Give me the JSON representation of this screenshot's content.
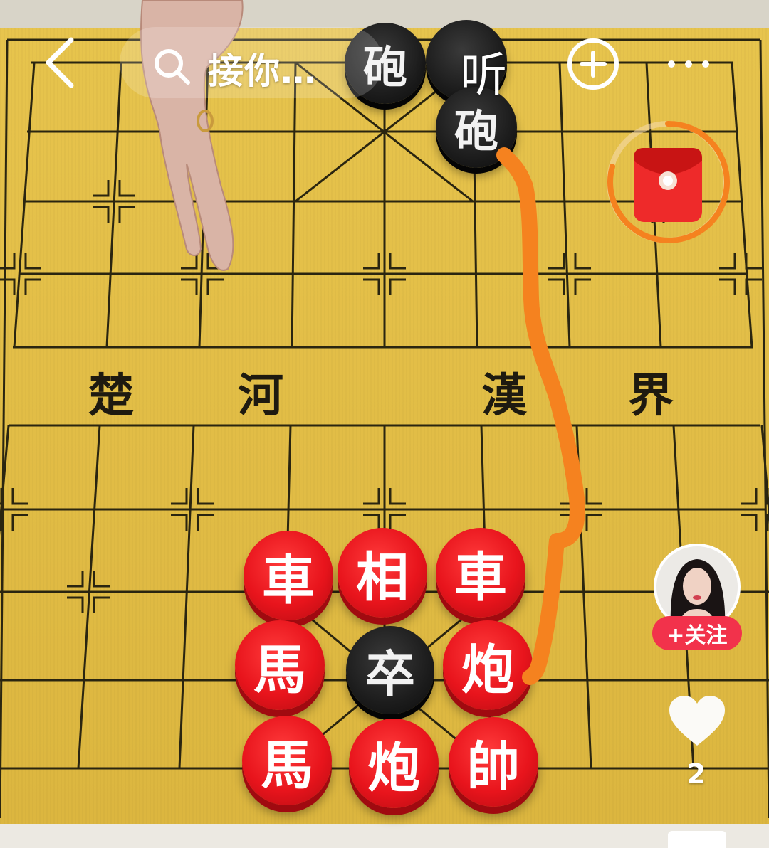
{
  "header": {
    "search_text": "接你…",
    "listen_label": "听"
  },
  "icons": {
    "back": "chevron-left-icon",
    "search": "search-icon",
    "add": "plus-circle-icon",
    "more": "more-dots-icon",
    "red_packet": "red-envelope-icon",
    "like": "heart-icon"
  },
  "board": {
    "river_chars": [
      "楚",
      "河",
      "漢",
      "界"
    ]
  },
  "pieces": {
    "black_cannon_a": "砲",
    "black_cannon_b": "砲",
    "red_chariot_left": "車",
    "red_elephant": "相",
    "red_chariot_right": "車",
    "red_horse_mid": "馬",
    "black_soldier": "卒",
    "red_cannon_mid": "炮",
    "red_horse_bottom": "馬",
    "red_cannon_bottom": "炮",
    "red_general": "帥"
  },
  "sidebar": {
    "follow_label": "+关注",
    "like_count": "2"
  },
  "colors": {
    "board": "#e2bd46",
    "red_piece": "#e8141c",
    "black_piece": "#1c1c1c",
    "path_stroke": "#f5821f",
    "follow_button": "#f2324b"
  }
}
